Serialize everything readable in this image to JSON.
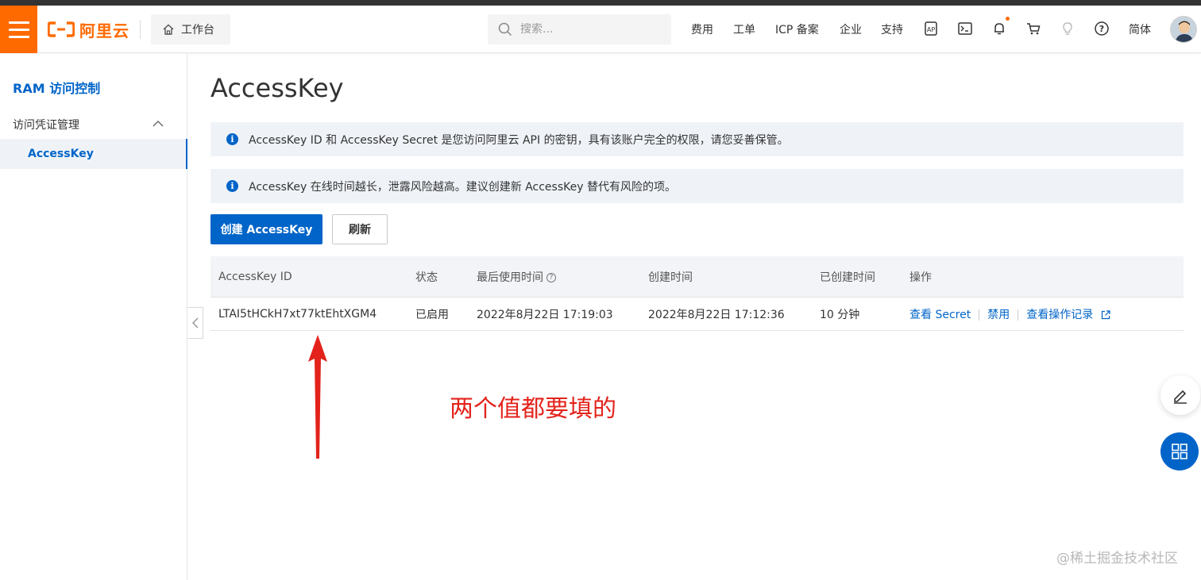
{
  "topbar": {
    "logo_text": "阿里云",
    "workbench_label": "工作台",
    "search_placeholder": "搜索...",
    "nav": [
      "费用",
      "工单",
      "ICP 备案",
      "企业",
      "支持"
    ],
    "lang": "简体"
  },
  "sidebar": {
    "title": "RAM 访问控制",
    "group_label": "访问凭证管理",
    "items": [
      {
        "label": "AccessKey"
      }
    ]
  },
  "main": {
    "title": "AccessKey",
    "alerts": [
      "AccessKey ID 和 AccessKey Secret 是您访问阿里云 API 的密钥，具有该账户完全的权限，请您妥善保管。",
      "AccessKey 在线时间越长，泄露风险越高。建议创建新 AccessKey 替代有风险的项。"
    ],
    "create_button": "创建 AccessKey",
    "refresh_button": "刷新",
    "table": {
      "headers": [
        "AccessKey ID",
        "状态",
        "最后使用时间",
        "创建时间",
        "已创建时间",
        "操作"
      ],
      "rows": [
        {
          "id": "LTAI5tHCkH7xt77ktEhtXGM4",
          "status": "已启用",
          "last_used": "2022年8月22日 17:19:03",
          "created": "2022年8月22日 17:12:36",
          "age": "10 分钟",
          "actions": [
            "查看 Secret",
            "禁用",
            "查看操作记录"
          ]
        }
      ]
    }
  },
  "annotation": "两个值都要填的",
  "watermark": "@稀土掘金技术社区",
  "colors": {
    "accent": "#0064c8",
    "brand": "#ff6a00",
    "annotation": "#e3231b"
  }
}
